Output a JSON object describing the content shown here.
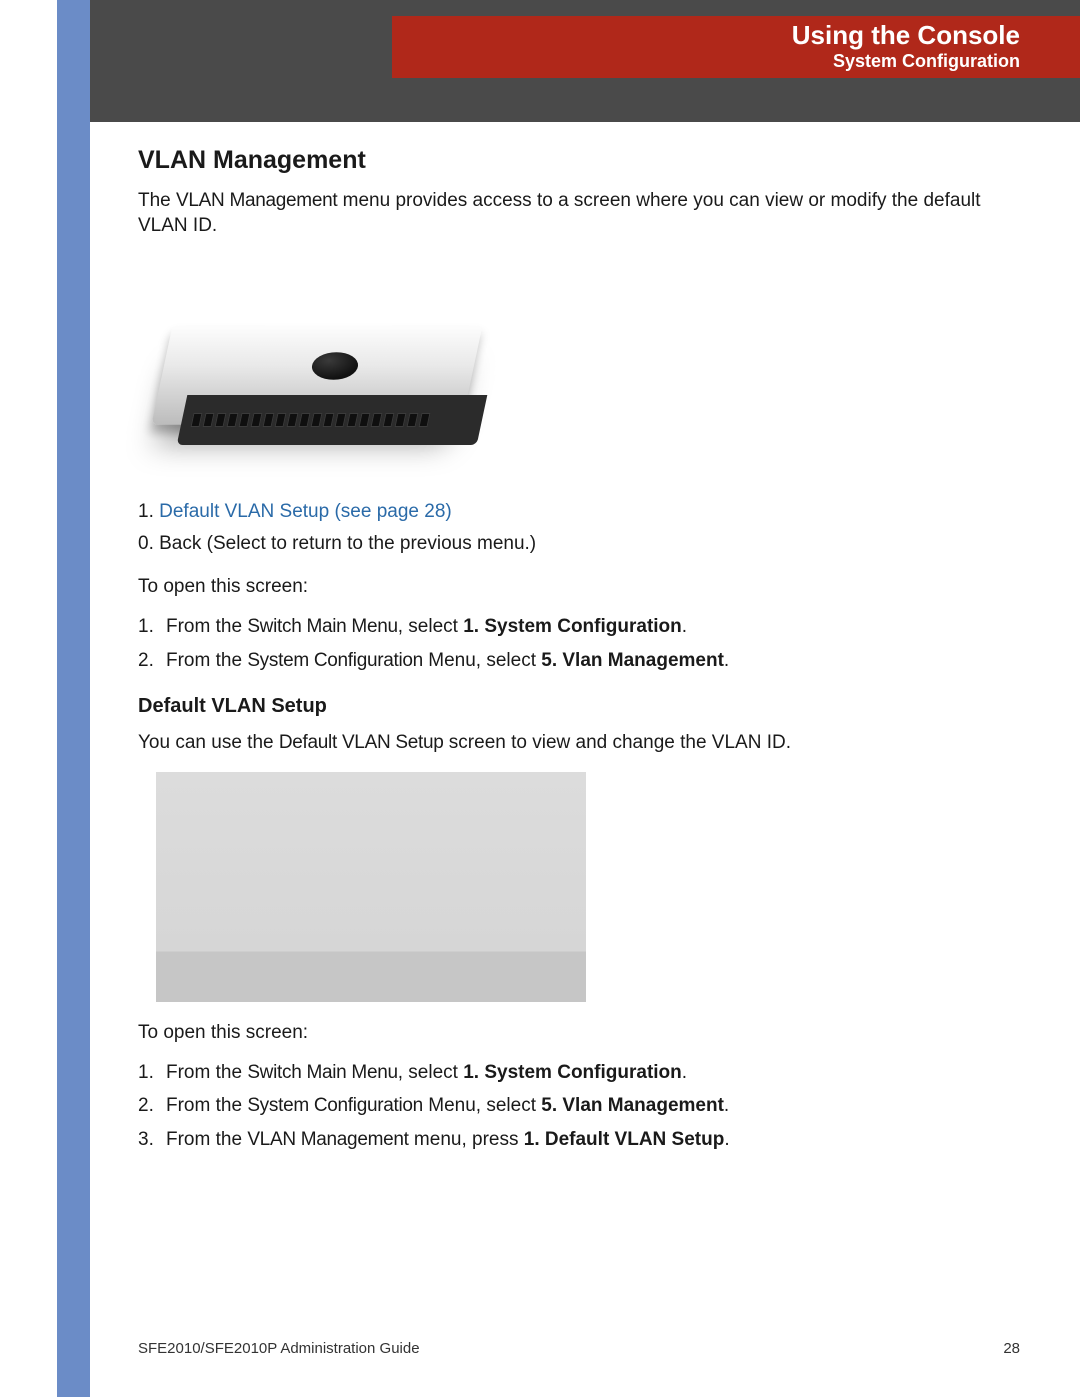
{
  "header": {
    "chapter_title": "Using the Console",
    "chapter_sub": "System Configuration"
  },
  "section": {
    "h2": "VLAN Management",
    "intro_1a": "The ",
    "intro_1b": "VLAN Management",
    "intro_1c": " menu provides access to a screen where you can view or modify the default VLAN ID.",
    "link_num": "1.",
    "link_text": "Default VLAN Setup (see page 28)",
    "back_line": "0. Back (Select to return to the previous menu.)",
    "open_lead": "To open this screen:",
    "step1_a": "From the ",
    "step1_b": "Switch Main Menu",
    "step1_c": ", select ",
    "step1_d": "1. System Configuration",
    "step1_e": ".",
    "step2_a": "From the ",
    "step2_b": "System Configuration",
    "step2_c": " Menu, select ",
    "step2_d": "5. Vlan Management",
    "step2_e": "."
  },
  "sub": {
    "h3": "Default VLAN Setup",
    "intro_a": "You can use the ",
    "intro_b": "Default VLAN Setup",
    "intro_c": " screen to view and change the VLAN ID.",
    "open_lead": "To open this screen:",
    "s1_a": "From the ",
    "s1_b": "Switch Main Menu",
    "s1_c": ", select ",
    "s1_d": "1. System Configuration",
    "s1_e": ".",
    "s2_a": "From the ",
    "s2_b": "System Configuration",
    "s2_c": " Menu, select ",
    "s2_d": "5. Vlan Management",
    "s2_e": ".",
    "s3_a": "From the ",
    "s3_b": "VLAN Management",
    "s3_c": " menu, press ",
    "s3_d": "1. Default VLAN Setup",
    "s3_e": "."
  },
  "footer": {
    "doc_title": "SFE2010/SFE2010P Administration Guide",
    "page_num": "28"
  },
  "list_numbers": {
    "n1": "1.",
    "n2": "2.",
    "n3": "3."
  }
}
